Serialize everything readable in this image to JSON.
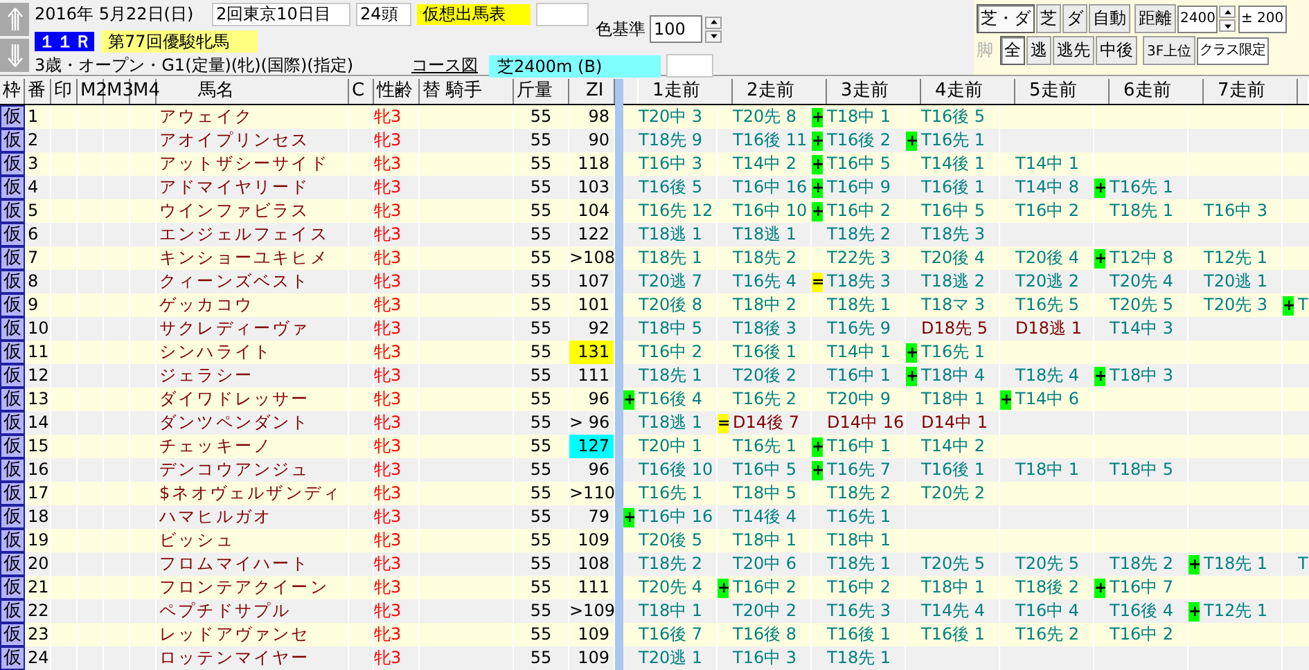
{
  "race_header": {
    "date": "2016年 5月22日(日)",
    "meeting": "2回東京10日目",
    "runners": "24頭",
    "card_type": "仮想出馬表",
    "race_number": "１１Ｒ",
    "race_name": "第77回優駿牝馬",
    "conditions": "3歳・オープン・G1(定量)(牝)(国際)(指定)",
    "course_link": "コース図",
    "course": "芝2400m (B)"
  },
  "color_basis": {
    "label": "色基準",
    "value": "100"
  },
  "filters": {
    "surface_buttons": [
      {
        "label": "芝・ダ",
        "selected": true
      },
      {
        "label": "芝",
        "selected": false
      },
      {
        "label": "ダ",
        "selected": false
      },
      {
        "label": "自動",
        "selected": false
      }
    ],
    "distance_button": "距離",
    "distance": "2400",
    "range": "± 200",
    "style_label": "脚",
    "style_buttons": [
      {
        "label": "全",
        "selected": true
      },
      {
        "label": "逃",
        "selected": false
      },
      {
        "label": "逃先",
        "selected": false
      },
      {
        "label": "中後",
        "selected": false
      }
    ],
    "top3f_button": "3F上位",
    "class_field": "クラス限定"
  },
  "columns": [
    "枠",
    "番",
    "印",
    "M2",
    "M3",
    "M4",
    "馬名",
    "C",
    "性齢",
    "替 騎手",
    "斤量",
    "ZI"
  ],
  "run_columns": [
    "1走前",
    "2走前",
    "3走前",
    "4走前",
    "5走前",
    "6走前",
    "7走前"
  ],
  "rows": [
    {
      "frame": "仮",
      "number": "1",
      "name": "アウェイク",
      "sex_age": "牝3",
      "weight": "55",
      "zi": {
        "text": "98"
      },
      "runs": [
        {
          "text": "T20中 3",
          "kind": "turf"
        },
        {
          "text": "T20先 8",
          "kind": "turf"
        },
        {
          "text": "T18中 1",
          "kind": "turf",
          "mark": {
            "text": "+",
            "color": "#00ff00"
          }
        },
        {
          "text": "T16後 5",
          "kind": "turf"
        }
      ]
    },
    {
      "frame": "仮",
      "number": "2",
      "name": "アオイプリンセス",
      "sex_age": "牝3",
      "weight": "55",
      "zi": {
        "text": "90"
      },
      "runs": [
        {
          "text": "T18先 9",
          "kind": "turf"
        },
        {
          "text": "T16後 11",
          "kind": "turf"
        },
        {
          "text": "T16後 2",
          "kind": "turf",
          "mark": {
            "text": "+",
            "color": "#00ff00"
          }
        },
        {
          "text": "T16先 1",
          "kind": "turf",
          "mark": {
            "text": "+",
            "color": "#00ff00"
          }
        }
      ]
    },
    {
      "frame": "仮",
      "number": "3",
      "name": "アットザシーサイド",
      "sex_age": "牝3",
      "weight": "55",
      "zi": {
        "text": "118"
      },
      "runs": [
        {
          "text": "T16中 3",
          "kind": "turf"
        },
        {
          "text": "T14中 2",
          "kind": "turf"
        },
        {
          "text": "T16中 5",
          "kind": "turf",
          "mark": {
            "text": "+",
            "color": "#00ff00"
          }
        },
        {
          "text": "T14後 1",
          "kind": "turf"
        },
        {
          "text": "T14中 1",
          "kind": "turf"
        }
      ]
    },
    {
      "frame": "仮",
      "number": "4",
      "name": "アドマイヤリード",
      "sex_age": "牝3",
      "weight": "55",
      "zi": {
        "text": "103"
      },
      "runs": [
        {
          "text": "T16後 5",
          "kind": "turf"
        },
        {
          "text": "T16中 16",
          "kind": "turf"
        },
        {
          "text": "T16中 9",
          "kind": "turf",
          "mark": {
            "text": "+",
            "color": "#00ff00"
          }
        },
        {
          "text": "T16後 1",
          "kind": "turf"
        },
        {
          "text": "T14中 8",
          "kind": "turf"
        },
        {
          "text": "T16先 1",
          "kind": "turf",
          "mark": {
            "text": "+",
            "color": "#00ff00"
          }
        }
      ]
    },
    {
      "frame": "仮",
      "number": "5",
      "name": "ウインファビラス",
      "sex_age": "牝3",
      "weight": "55",
      "zi": {
        "text": "104"
      },
      "runs": [
        {
          "text": "T16先 12",
          "kind": "turf"
        },
        {
          "text": "T16中 10",
          "kind": "turf"
        },
        {
          "text": "T16中 2",
          "kind": "turf",
          "mark": {
            "text": "+",
            "color": "#00ff00"
          }
        },
        {
          "text": "T16中 5",
          "kind": "turf"
        },
        {
          "text": "T16中 2",
          "kind": "turf"
        },
        {
          "text": "T18先 1",
          "kind": "turf"
        },
        {
          "text": "T16中 3",
          "kind": "turf"
        }
      ]
    },
    {
      "frame": "仮",
      "number": "6",
      "name": "エンジェルフェイス",
      "sex_age": "牝3",
      "weight": "55",
      "zi": {
        "text": "122"
      },
      "runs": [
        {
          "text": "T18逃 1",
          "kind": "turf"
        },
        {
          "text": "T18逃 1",
          "kind": "turf"
        },
        {
          "text": "T18先 2",
          "kind": "turf"
        },
        {
          "text": "T18先 3",
          "kind": "turf"
        }
      ]
    },
    {
      "frame": "仮",
      "number": "7",
      "name": "キンショーユキヒメ",
      "sex_age": "牝3",
      "weight": "55",
      "zi": {
        "text": ">108"
      },
      "runs": [
        {
          "text": "T18先 1",
          "kind": "turf"
        },
        {
          "text": "T18先 2",
          "kind": "turf"
        },
        {
          "text": "T22先 3",
          "kind": "turf"
        },
        {
          "text": "T20後 4",
          "kind": "turf"
        },
        {
          "text": "T20後 4",
          "kind": "turf"
        },
        {
          "text": "T12中 8",
          "kind": "turf",
          "mark": {
            "text": "+",
            "color": "#00ff00"
          }
        },
        {
          "text": "T12先 1",
          "kind": "turf"
        }
      ]
    },
    {
      "frame": "仮",
      "number": "8",
      "name": "クィーンズベスト",
      "sex_age": "牝3",
      "weight": "55",
      "zi": {
        "text": "107"
      },
      "runs": [
        {
          "text": "T20逃 7",
          "kind": "turf"
        },
        {
          "text": "T16先 4",
          "kind": "turf"
        },
        {
          "text": "T18先 3",
          "kind": "turf",
          "mark": {
            "text": "=",
            "color": "#ffff00"
          }
        },
        {
          "text": "T18逃 2",
          "kind": "turf"
        },
        {
          "text": "T20逃 2",
          "kind": "turf"
        },
        {
          "text": "T20先 4",
          "kind": "turf"
        },
        {
          "text": "T20逃 1",
          "kind": "turf"
        }
      ]
    },
    {
      "frame": "仮",
      "number": "9",
      "name": "ゲッカコウ",
      "sex_age": "牝3",
      "weight": "55",
      "zi": {
        "text": "101"
      },
      "runs": [
        {
          "text": "T20後 8",
          "kind": "turf"
        },
        {
          "text": "T18中 2",
          "kind": "turf"
        },
        {
          "text": "T18先 1",
          "kind": "turf"
        },
        {
          "text": "T18マ 3",
          "kind": "turf"
        },
        {
          "text": "T16先 5",
          "kind": "turf"
        },
        {
          "text": "T20先 5",
          "kind": "turf"
        },
        {
          "text": "T20先 3",
          "kind": "turf"
        },
        {
          "text": "T",
          "kind": "turf",
          "mark": {
            "text": "+",
            "color": "#00ff00"
          }
        }
      ]
    },
    {
      "frame": "仮",
      "number": "10",
      "name": "サクレディーヴァ",
      "sex_age": "牝3",
      "weight": "55",
      "zi": {
        "text": "92"
      },
      "runs": [
        {
          "text": "T18中 5",
          "kind": "turf"
        },
        {
          "text": "T18後 3",
          "kind": "turf"
        },
        {
          "text": "T16先 9",
          "kind": "turf"
        },
        {
          "text": "D18先 5",
          "kind": "dirt"
        },
        {
          "text": "D18逃 1",
          "kind": "dirt"
        },
        {
          "text": "T14中 3",
          "kind": "turf"
        }
      ]
    },
    {
      "frame": "仮",
      "number": "11",
      "name": "シンハライト",
      "sex_age": "牝3",
      "weight": "55",
      "zi": {
        "text": "131",
        "color": "#ffff00"
      },
      "runs": [
        {
          "text": "T16中 2",
          "kind": "turf"
        },
        {
          "text": "T16後 1",
          "kind": "turf"
        },
        {
          "text": "T14中 1",
          "kind": "turf"
        },
        {
          "text": "T16先 1",
          "kind": "turf",
          "mark": {
            "text": "+",
            "color": "#00ff00"
          }
        }
      ]
    },
    {
      "frame": "仮",
      "number": "12",
      "name": "ジェラシー",
      "sex_age": "牝3",
      "weight": "55",
      "zi": {
        "text": "111"
      },
      "runs": [
        {
          "text": "T18先 1",
          "kind": "turf"
        },
        {
          "text": "T20後 2",
          "kind": "turf"
        },
        {
          "text": "T16中 1",
          "kind": "turf"
        },
        {
          "text": "T18中 4",
          "kind": "turf",
          "mark": {
            "text": "+",
            "color": "#00ff00"
          }
        },
        {
          "text": "T18先 4",
          "kind": "turf"
        },
        {
          "text": "T18中 3",
          "kind": "turf",
          "mark": {
            "text": "+",
            "color": "#00ff00"
          }
        }
      ]
    },
    {
      "frame": "仮",
      "number": "13",
      "name": "ダイワドレッサー",
      "sex_age": "牝3",
      "weight": "55",
      "zi": {
        "text": "96"
      },
      "runs": [
        {
          "text": "T16後 4",
          "kind": "turf",
          "mark": {
            "text": "+",
            "color": "#00ff00"
          }
        },
        {
          "text": "T16先 2",
          "kind": "turf"
        },
        {
          "text": "T20中 9",
          "kind": "turf"
        },
        {
          "text": "T18中 1",
          "kind": "turf"
        },
        {
          "text": "T14中 6",
          "kind": "turf",
          "mark": {
            "text": "+",
            "color": "#00ff00"
          }
        }
      ]
    },
    {
      "frame": "仮",
      "number": "14",
      "name": "ダンツペンダント",
      "sex_age": "牝3",
      "weight": "55",
      "zi": {
        "text": "> 96"
      },
      "runs": [
        {
          "text": "T18逃 1",
          "kind": "turf"
        },
        {
          "text": "D14後 7",
          "kind": "dirt",
          "mark": {
            "text": "=",
            "color": "#ffff00"
          }
        },
        {
          "text": "D14中 16",
          "kind": "dirt"
        },
        {
          "text": "D14中 1",
          "kind": "dirt"
        }
      ]
    },
    {
      "frame": "仮",
      "number": "15",
      "name": "チェッキーノ",
      "sex_age": "牝3",
      "weight": "55",
      "zi": {
        "text": "127",
        "color": "#00ffff"
      },
      "runs": [
        {
          "text": "T20中 1",
          "kind": "turf"
        },
        {
          "text": "T16先 1",
          "kind": "turf"
        },
        {
          "text": "T16中 1",
          "kind": "turf",
          "mark": {
            "text": "+",
            "color": "#00ff00"
          }
        },
        {
          "text": "T14中 2",
          "kind": "turf"
        }
      ]
    },
    {
      "frame": "仮",
      "number": "16",
      "name": "デンコウアンジュ",
      "sex_age": "牝3",
      "weight": "55",
      "zi": {
        "text": "96"
      },
      "runs": [
        {
          "text": "T16後 10",
          "kind": "turf"
        },
        {
          "text": "T16中 5",
          "kind": "turf"
        },
        {
          "text": "T16先 7",
          "kind": "turf",
          "mark": {
            "text": "+",
            "color": "#00ff00"
          }
        },
        {
          "text": "T16後 1",
          "kind": "turf"
        },
        {
          "text": "T18中 1",
          "kind": "turf"
        },
        {
          "text": "T18中 5",
          "kind": "turf"
        }
      ]
    },
    {
      "frame": "仮",
      "number": "17",
      "name": "$ネオヴェルザンディ",
      "sex_age": "牝3",
      "weight": "55",
      "zi": {
        "text": ">110"
      },
      "runs": [
        {
          "text": "T16先 1",
          "kind": "turf"
        },
        {
          "text": "T18中 5",
          "kind": "turf"
        },
        {
          "text": "T18先 2",
          "kind": "turf"
        },
        {
          "text": "T20先 2",
          "kind": "turf"
        }
      ]
    },
    {
      "frame": "仮",
      "number": "18",
      "name": "ハマヒルガオ",
      "sex_age": "牝3",
      "weight": "55",
      "zi": {
        "text": "79"
      },
      "runs": [
        {
          "text": "T16中 16",
          "kind": "turf",
          "mark": {
            "text": "+",
            "color": "#00ff00"
          }
        },
        {
          "text": "T14後 4",
          "kind": "turf"
        },
        {
          "text": "T16先 1",
          "kind": "turf"
        }
      ]
    },
    {
      "frame": "仮",
      "number": "19",
      "name": "ビッシュ",
      "sex_age": "牝3",
      "weight": "55",
      "zi": {
        "text": "109"
      },
      "runs": [
        {
          "text": "T20後 5",
          "kind": "turf"
        },
        {
          "text": "T18中 1",
          "kind": "turf"
        },
        {
          "text": "T18中 1",
          "kind": "turf"
        }
      ]
    },
    {
      "frame": "仮",
      "number": "20",
      "name": "フロムマイハート",
      "sex_age": "牝3",
      "weight": "55",
      "zi": {
        "text": "108"
      },
      "runs": [
        {
          "text": "T18先 2",
          "kind": "turf"
        },
        {
          "text": "T20中 6",
          "kind": "turf"
        },
        {
          "text": "T18先 1",
          "kind": "turf"
        },
        {
          "text": "T20先 5",
          "kind": "turf"
        },
        {
          "text": "T20先 5",
          "kind": "turf"
        },
        {
          "text": "T18先 2",
          "kind": "turf"
        },
        {
          "text": "T18先 1",
          "kind": "turf",
          "mark": {
            "text": "+",
            "color": "#00ff00"
          }
        },
        {
          "text": "T",
          "kind": "turf"
        }
      ]
    },
    {
      "frame": "仮",
      "number": "21",
      "name": "フロンテアクイーン",
      "sex_age": "牝3",
      "weight": "55",
      "zi": {
        "text": "111"
      },
      "runs": [
        {
          "text": "T20先 4",
          "kind": "turf"
        },
        {
          "text": "T16中 2",
          "kind": "turf",
          "mark": {
            "text": "+",
            "color": "#00ff00"
          }
        },
        {
          "text": "T16中 2",
          "kind": "turf"
        },
        {
          "text": "T18中 1",
          "kind": "turf"
        },
        {
          "text": "T18後 2",
          "kind": "turf"
        },
        {
          "text": "T16中 7",
          "kind": "turf",
          "mark": {
            "text": "+",
            "color": "#00ff00"
          }
        }
      ]
    },
    {
      "frame": "仮",
      "number": "22",
      "name": "ペプチドサプル",
      "sex_age": "牝3",
      "weight": "55",
      "zi": {
        "text": ">109"
      },
      "runs": [
        {
          "text": "T18中 1",
          "kind": "turf"
        },
        {
          "text": "T20中 2",
          "kind": "turf"
        },
        {
          "text": "T16先 3",
          "kind": "turf"
        },
        {
          "text": "T14先 4",
          "kind": "turf"
        },
        {
          "text": "T16中 4",
          "kind": "turf"
        },
        {
          "text": "T16後 4",
          "kind": "turf"
        },
        {
          "text": "T12先 1",
          "kind": "turf",
          "mark": {
            "text": "+",
            "color": "#00ff00"
          }
        }
      ]
    },
    {
      "frame": "仮",
      "number": "23",
      "name": "レッドアヴァンセ",
      "sex_age": "牝3",
      "weight": "55",
      "zi": {
        "text": "109"
      },
      "runs": [
        {
          "text": "T16後 7",
          "kind": "turf"
        },
        {
          "text": "T16後 8",
          "kind": "turf"
        },
        {
          "text": "T16後 1",
          "kind": "turf"
        },
        {
          "text": "T16後 1",
          "kind": "turf"
        },
        {
          "text": "T16先 2",
          "kind": "turf"
        },
        {
          "text": "T16中 2",
          "kind": "turf"
        }
      ]
    },
    {
      "frame": "仮",
      "number": "24",
      "name": "ロッテンマイヤー",
      "sex_age": "牝3",
      "weight": "55",
      "zi": {
        "text": "109"
      },
      "runs": [
        {
          "text": "T20逃 1",
          "kind": "turf"
        },
        {
          "text": "T16中 3",
          "kind": "turf"
        },
        {
          "text": "T18先 1",
          "kind": "turf"
        }
      ]
    }
  ]
}
